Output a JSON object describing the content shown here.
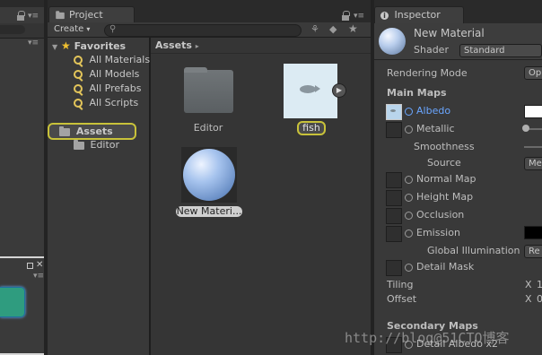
{
  "project": {
    "tab_label": "Project",
    "create_label": "Create",
    "search_placeholder": ""
  },
  "favorites": {
    "header": "Favorites",
    "items": [
      {
        "label": "All Materials"
      },
      {
        "label": "All Models"
      },
      {
        "label": "All Prefabs"
      },
      {
        "label": "All Scripts"
      }
    ]
  },
  "assets_tree": {
    "root": "Assets",
    "children": [
      {
        "label": "Editor"
      }
    ]
  },
  "asset_grid": {
    "breadcrumb": "Assets",
    "items": [
      {
        "label": "Editor"
      },
      {
        "label": "fish"
      },
      {
        "label": "New Materi..."
      }
    ]
  },
  "inspector": {
    "tab_label": "Inspector",
    "material_name": "New Material",
    "shader_label": "Shader",
    "shader_value": "Standard",
    "rendering_mode_label": "Rendering Mode",
    "rendering_mode_value": "Op",
    "main_maps_header": "Main Maps",
    "albedo_label": "Albedo",
    "metallic_label": "Metallic",
    "smoothness_label": "Smoothness",
    "source_label": "Source",
    "source_value": "Me",
    "normal_map_label": "Normal Map",
    "height_map_label": "Height Map",
    "occlusion_label": "Occlusion",
    "emission_label": "Emission",
    "global_illumination_label": "Global Illumination",
    "global_illumination_value": "Re",
    "detail_mask_label": "Detail Mask",
    "tiling_label": "Tiling",
    "tiling_x": "X",
    "tiling_value": "1",
    "offset_label": "Offset",
    "offset_x": "X",
    "offset_value": "0",
    "secondary_maps_header": "Secondary Maps",
    "detail_albedo_label": "Detail Albedo x2"
  },
  "watermark": "http://blog@51CTO博客",
  "colors": {
    "selection_outline": "#c8c23a",
    "albedo_accent": "#6aa6ff"
  }
}
